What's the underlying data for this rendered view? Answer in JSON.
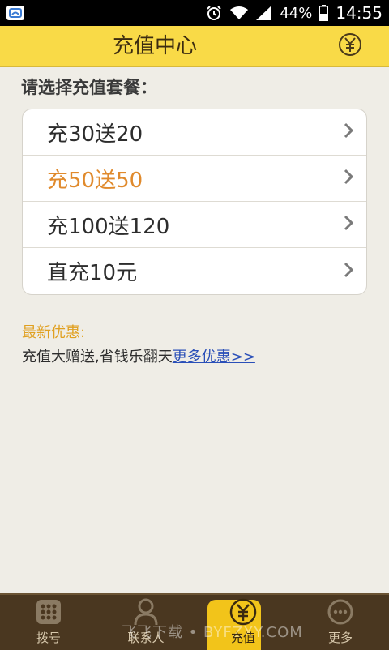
{
  "status_bar": {
    "battery": "44%",
    "time": "14:55"
  },
  "header": {
    "title": "充值中心",
    "yuan_icon": "yuan-icon"
  },
  "main": {
    "prompt": "请选择充值套餐：",
    "packages": [
      {
        "label": "充30送20"
      },
      {
        "label": "充50送50"
      },
      {
        "label": "充100送120"
      },
      {
        "label": "直充10元"
      }
    ],
    "offers": {
      "title": "最新优惠:",
      "text": "充值大赠送,省钱乐翻天",
      "link": "更多优惠>>"
    }
  },
  "bottom_nav": {
    "tabs": [
      {
        "label": "拨号",
        "icon": "dialpad-icon"
      },
      {
        "label": "联系人",
        "icon": "contact-icon"
      },
      {
        "label": "充值",
        "icon": "yuan-icon"
      },
      {
        "label": "更多",
        "icon": "more-icon"
      }
    ]
  },
  "watermark": "飞飞下载 • BYFZXY.COM",
  "colors": {
    "accent": "#f9da47",
    "highlight_text": "#e08a2c",
    "link": "#2a4fb8",
    "nav_bg": "#4a3720"
  }
}
